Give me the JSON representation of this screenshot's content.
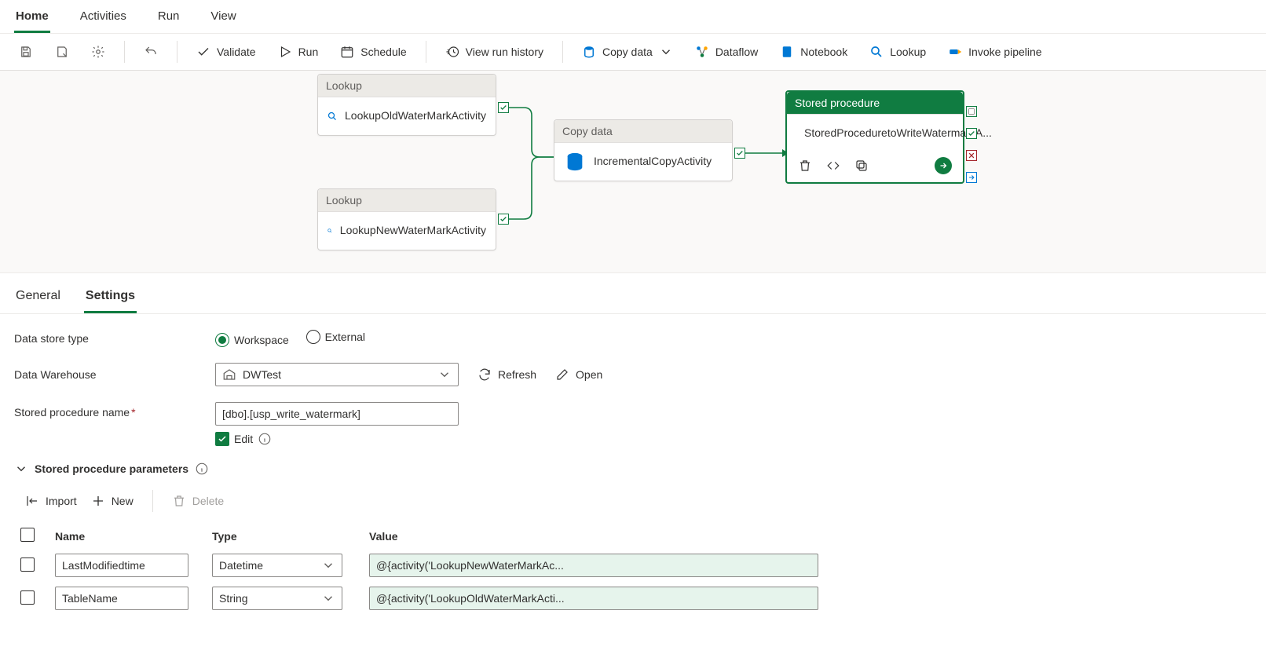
{
  "topTabs": {
    "home": "Home",
    "activities": "Activities",
    "run": "Run",
    "view": "View"
  },
  "toolbar": {
    "validate": "Validate",
    "run": "Run",
    "schedule": "Schedule",
    "viewRunHistory": "View run history",
    "copyData": "Copy data",
    "dataflow": "Dataflow",
    "notebook": "Notebook",
    "lookup": "Lookup",
    "invokePipeline": "Invoke pipeline"
  },
  "nodes": {
    "lookup1": {
      "type": "Lookup",
      "title": "LookupOldWaterMarkActivity"
    },
    "lookup2": {
      "type": "Lookup",
      "title": "LookupNewWaterMarkActivity"
    },
    "copy": {
      "type": "Copy data",
      "title": "IncrementalCopyActivity"
    },
    "sp": {
      "type": "Stored procedure",
      "title": "StoredProceduretoWriteWatermarkA..."
    }
  },
  "panelTabs": {
    "general": "General",
    "settings": "Settings"
  },
  "settings": {
    "dataStoreTypeLabel": "Data store type",
    "workspace": "Workspace",
    "external": "External",
    "dataWarehouseLabel": "Data Warehouse",
    "dataWarehouseValue": "DWTest",
    "refresh": "Refresh",
    "open": "Open",
    "spNameLabel": "Stored procedure name",
    "spNameValue": "[dbo].[usp_write_watermark]",
    "edit": "Edit",
    "paramsHeader": "Stored procedure parameters",
    "import": "Import",
    "new": "New",
    "delete": "Delete",
    "cols": {
      "name": "Name",
      "type": "Type",
      "value": "Value"
    },
    "rows": [
      {
        "name": "LastModifiedtime",
        "type": "Datetime",
        "value": "@{activity('LookupNewWaterMarkAc..."
      },
      {
        "name": "TableName",
        "type": "String",
        "value": "@{activity('LookupOldWaterMarkActi..."
      }
    ]
  }
}
